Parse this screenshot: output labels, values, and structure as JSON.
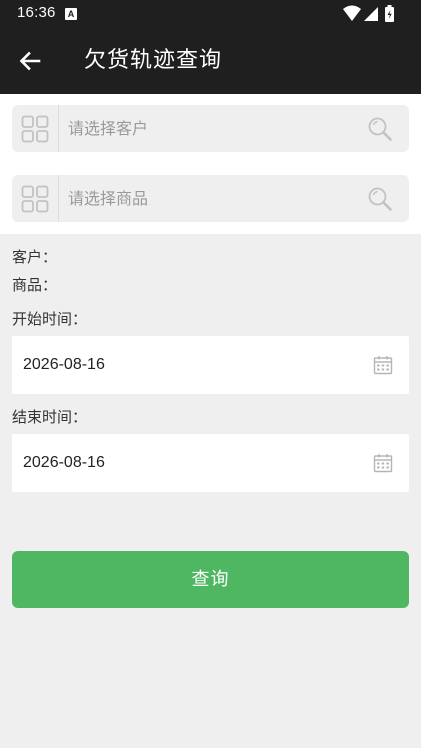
{
  "status_bar": {
    "time": "16:36",
    "notification_icon": "A"
  },
  "app_bar": {
    "title": "欠货轨迹查询",
    "back_icon": "arrow-left"
  },
  "customer_search": {
    "placeholder": "请选择客户",
    "left_icon": "grid-icon",
    "right_icon": "search-icon"
  },
  "goods_search": {
    "placeholder": "请选择商品",
    "left_icon": "grid-icon",
    "right_icon": "search-icon"
  },
  "info": {
    "customer_label": "客户：",
    "goods_label": "商品："
  },
  "start_time": {
    "label": "开始时间：",
    "value": "2026-08-16"
  },
  "end_time": {
    "label": "结束时间：",
    "value": "2026-08-16"
  },
  "query_button": {
    "label": "查询"
  },
  "colors": {
    "app_bar": "#1f1f1f",
    "background": "#efefef",
    "primary_button": "#4fb762"
  }
}
